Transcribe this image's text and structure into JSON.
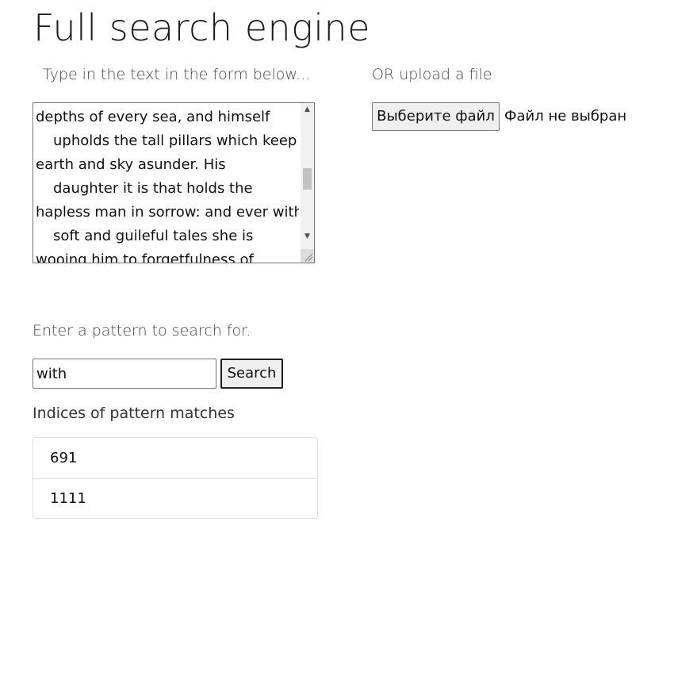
{
  "page": {
    "title": "Full search engine"
  },
  "text_section": {
    "label": "Type in the text in the form below...",
    "lines": [
      {
        "text": "depths of every sea, and himself",
        "indent": false
      },
      {
        "text": "upholds the tall pillars which keep",
        "indent": true
      },
      {
        "text": "earth and sky asunder. His",
        "indent": false
      },
      {
        "text": "daughter it is that holds the",
        "indent": true
      },
      {
        "text": "hapless man in sorrow: and ever with",
        "indent": false
      },
      {
        "text": "soft and guileful tales she is",
        "indent": true
      },
      {
        "text": "wooing him to forgetfulness of",
        "indent": false
      }
    ]
  },
  "upload_section": {
    "label": "OR upload a file",
    "button_label": "Выберите файл",
    "status": "Файл не выбран"
  },
  "search_section": {
    "label": "Enter a pattern to search for.",
    "input_value": "with",
    "button_label": "Search"
  },
  "results": {
    "heading": "Indices of pattern matches",
    "items": [
      "691",
      "1111"
    ]
  },
  "icons": {
    "scroll_up": "triangle-up",
    "scroll_down": "triangle-down",
    "resize": "resize-grip"
  }
}
